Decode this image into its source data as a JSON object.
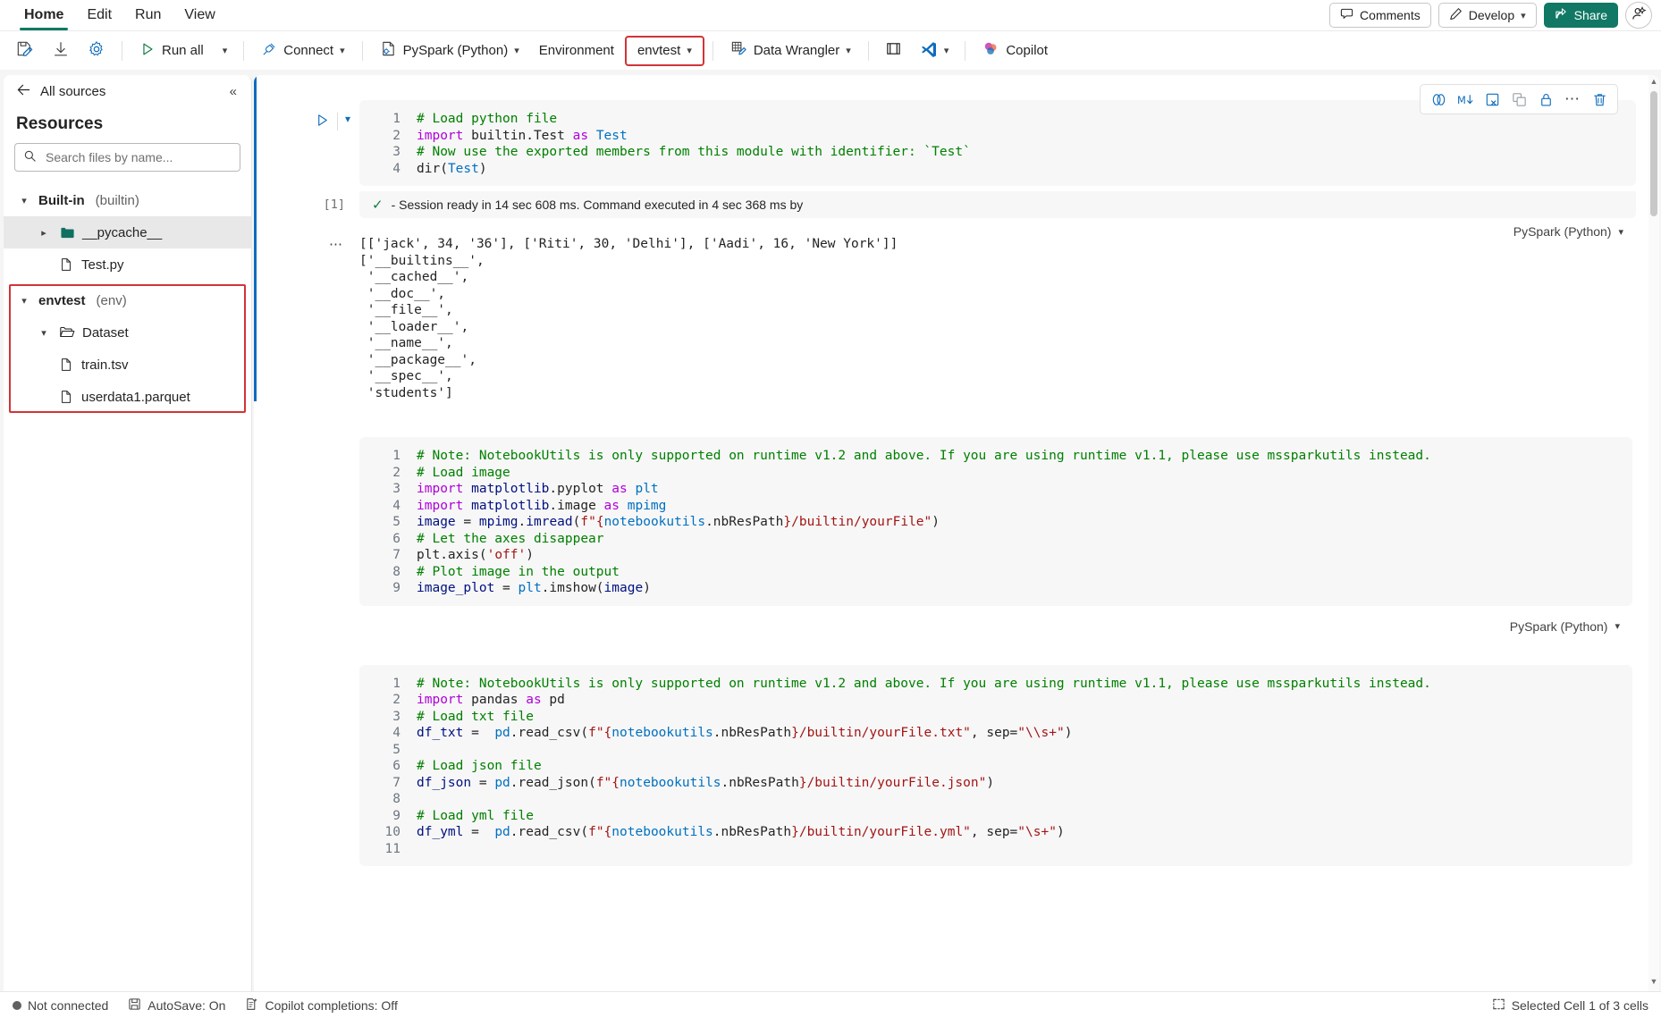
{
  "ribbon": {
    "tabs": [
      {
        "label": "Home",
        "active": true
      },
      {
        "label": "Edit",
        "active": false
      },
      {
        "label": "Run",
        "active": false
      },
      {
        "label": "View",
        "active": false
      }
    ],
    "comments_label": "Comments",
    "develop_label": "Develop",
    "share_label": "Share"
  },
  "toolbar": {
    "run_all_label": "Run all",
    "connect_label": "Connect",
    "kernel_label": "PySpark (Python)",
    "environment_label": "Environment",
    "env_name_label": "envtest",
    "data_wrangler_label": "Data Wrangler",
    "copilot_label": "Copilot",
    "highlight_color": "#d13438"
  },
  "sidebar": {
    "back_label": "All sources",
    "title": "Resources",
    "search_placeholder": "Search files by name...",
    "search_value": "",
    "groups": [
      {
        "name": "Built-in",
        "suffix": "(builtin)",
        "expanded": true,
        "items": [
          {
            "label": "__pycache__",
            "type": "folder-filled",
            "indent": 1,
            "expanded": false,
            "selected": true
          },
          {
            "label": "Test.py",
            "type": "file",
            "indent": 2,
            "selected": false
          }
        ]
      },
      {
        "name": "envtest",
        "suffix": "(env)",
        "expanded": true,
        "highlighted": true,
        "items": [
          {
            "label": "Dataset",
            "type": "folder-open",
            "indent": 1,
            "expanded": true,
            "selected": false
          },
          {
            "label": "train.tsv",
            "type": "file",
            "indent": 2,
            "selected": false
          },
          {
            "label": "userdata1.parquet",
            "type": "file",
            "indent": 2,
            "selected": false
          }
        ]
      }
    ]
  },
  "notebook": {
    "cell_toolbar_icons": [
      "undo-cell-icon",
      "markdown-icon",
      "clear-output-icon",
      "copy-cell-icon",
      "lock-icon",
      "more-options-icon",
      "delete-cell-icon"
    ],
    "cells": [
      {
        "execution_count": "[1]",
        "selected": true,
        "language": "PySpark (Python)",
        "status_text": "- Session ready in 14 sec 608 ms. Command executed in 4 sec 368 ms by",
        "lines": [
          [
            {
              "t": "# Load python file",
              "c": "c-com"
            }
          ],
          [
            {
              "t": "import ",
              "c": "c-kw"
            },
            {
              "t": "builtin.Test ",
              "c": "ctext"
            },
            {
              "t": "as ",
              "c": "c-kw"
            },
            {
              "t": "Test",
              "c": "c-id"
            }
          ],
          [
            {
              "t": "# Now use the exported members from this module with identifier: `Test`",
              "c": "c-com"
            }
          ],
          [
            {
              "t": "dir",
              "c": "ctext"
            },
            {
              "t": "(",
              "c": "ctext"
            },
            {
              "t": "Test",
              "c": "c-id"
            },
            {
              "t": ")",
              "c": "ctext"
            }
          ]
        ],
        "output": "[['jack', 34, '36'], ['Riti', 30, 'Delhi'], ['Aadi', 16, 'New York']]\n['__builtins__',\n '__cached__',\n '__doc__',\n '__file__',\n '__loader__',\n '__name__',\n '__package__',\n '__spec__',\n 'students']"
      },
      {
        "execution_count": "",
        "selected": false,
        "language": "PySpark (Python)",
        "status_text": "",
        "lines": [
          [
            {
              "t": "# Note: NotebookUtils is only supported on runtime v1.2 and above. If you are using runtime v1.1, please use mssparkutils instead.",
              "c": "c-com"
            }
          ],
          [
            {
              "t": "# Load image",
              "c": "c-com"
            }
          ],
          [
            {
              "t": "import ",
              "c": "c-kw"
            },
            {
              "t": "matplotlib",
              "c": "c-var"
            },
            {
              "t": ".pyplot ",
              "c": "ctext"
            },
            {
              "t": "as ",
              "c": "c-kw"
            },
            {
              "t": "plt",
              "c": "c-id"
            }
          ],
          [
            {
              "t": "import ",
              "c": "c-kw"
            },
            {
              "t": "matplotlib",
              "c": "c-var"
            },
            {
              "t": ".image ",
              "c": "ctext"
            },
            {
              "t": "as ",
              "c": "c-kw"
            },
            {
              "t": "mpimg",
              "c": "c-id"
            }
          ],
          [
            {
              "t": "image ",
              "c": "c-var"
            },
            {
              "t": "= ",
              "c": "ctext"
            },
            {
              "t": "mpimg",
              "c": "c-var"
            },
            {
              "t": ".",
              "c": "ctext"
            },
            {
              "t": "imread",
              "c": "c-var"
            },
            {
              "t": "(",
              "c": "ctext"
            },
            {
              "t": "f\"{",
              "c": "c-str"
            },
            {
              "t": "notebookutils",
              "c": "c-id"
            },
            {
              "t": ".nbResPath",
              "c": "ctext"
            },
            {
              "t": "}",
              "c": "c-str"
            },
            {
              "t": "/builtin/yourFile\"",
              "c": "c-str"
            },
            {
              "t": ")",
              "c": "ctext"
            }
          ],
          [
            {
              "t": "# Let the axes disappear",
              "c": "c-com"
            }
          ],
          [
            {
              "t": "plt",
              "c": "ctext"
            },
            {
              "t": ".axis(",
              "c": "ctext"
            },
            {
              "t": "'off'",
              "c": "c-str"
            },
            {
              "t": ")",
              "c": "ctext"
            }
          ],
          [
            {
              "t": "# Plot image in the output",
              "c": "c-com"
            }
          ],
          [
            {
              "t": "image_plot ",
              "c": "c-var"
            },
            {
              "t": "= ",
              "c": "ctext"
            },
            {
              "t": "plt",
              "c": "c-id"
            },
            {
              "t": ".imshow(",
              "c": "ctext"
            },
            {
              "t": "image",
              "c": "c-var"
            },
            {
              "t": ")",
              "c": "ctext"
            }
          ]
        ],
        "output": ""
      },
      {
        "execution_count": "",
        "selected": false,
        "language": "",
        "status_text": "",
        "lines": [
          [
            {
              "t": "# Note: NotebookUtils is only supported on runtime v1.2 and above. If you are using runtime v1.1, please use mssparkutils instead.",
              "c": "c-com"
            }
          ],
          [
            {
              "t": "import ",
              "c": "c-kw"
            },
            {
              "t": "pandas ",
              "c": "ctext"
            },
            {
              "t": "as ",
              "c": "c-kw"
            },
            {
              "t": "pd",
              "c": "ctext"
            }
          ],
          [
            {
              "t": "# Load txt file",
              "c": "c-com"
            }
          ],
          [
            {
              "t": "df_txt ",
              "c": "c-var"
            },
            {
              "t": "=  ",
              "c": "ctext"
            },
            {
              "t": "pd",
              "c": "c-id"
            },
            {
              "t": ".read_csv(",
              "c": "ctext"
            },
            {
              "t": "f\"{",
              "c": "c-str"
            },
            {
              "t": "notebookutils",
              "c": "c-id"
            },
            {
              "t": ".nbResPath",
              "c": "ctext"
            },
            {
              "t": "}",
              "c": "c-str"
            },
            {
              "t": "/builtin/yourFile.txt\"",
              "c": "c-str"
            },
            {
              "t": ", sep=",
              "c": "ctext"
            },
            {
              "t": "\"\\\\s+\"",
              "c": "c-str"
            },
            {
              "t": ")",
              "c": "ctext"
            }
          ],
          [
            {
              "t": "",
              "c": "ctext"
            }
          ],
          [
            {
              "t": "# Load json file",
              "c": "c-com"
            }
          ],
          [
            {
              "t": "df_json ",
              "c": "c-var"
            },
            {
              "t": "= ",
              "c": "ctext"
            },
            {
              "t": "pd",
              "c": "c-id"
            },
            {
              "t": ".read_json(",
              "c": "ctext"
            },
            {
              "t": "f\"{",
              "c": "c-str"
            },
            {
              "t": "notebookutils",
              "c": "c-id"
            },
            {
              "t": ".nbResPath",
              "c": "ctext"
            },
            {
              "t": "}",
              "c": "c-str"
            },
            {
              "t": "/builtin/yourFile.json\"",
              "c": "c-str"
            },
            {
              "t": ")",
              "c": "ctext"
            }
          ],
          [
            {
              "t": "",
              "c": "ctext"
            }
          ],
          [
            {
              "t": "# Load yml file",
              "c": "c-com"
            }
          ],
          [
            {
              "t": "df_yml ",
              "c": "c-var"
            },
            {
              "t": "=  ",
              "c": "ctext"
            },
            {
              "t": "pd",
              "c": "c-id"
            },
            {
              "t": ".read_csv(",
              "c": "ctext"
            },
            {
              "t": "f\"{",
              "c": "c-str"
            },
            {
              "t": "notebookutils",
              "c": "c-id"
            },
            {
              "t": ".nbResPath",
              "c": "ctext"
            },
            {
              "t": "}",
              "c": "c-str"
            },
            {
              "t": "/builtin/yourFile.yml\"",
              "c": "c-str"
            },
            {
              "t": ", sep=",
              "c": "ctext"
            },
            {
              "t": "\"\\s+\"",
              "c": "c-str"
            },
            {
              "t": ")",
              "c": "ctext"
            }
          ],
          [
            {
              "t": "",
              "c": "ctext"
            }
          ]
        ],
        "output": ""
      }
    ]
  },
  "statusbar": {
    "connection": "Not connected",
    "autosave": "AutoSave: On",
    "copilot": "Copilot completions: Off",
    "selection": "Selected Cell 1 of 3 cells"
  }
}
